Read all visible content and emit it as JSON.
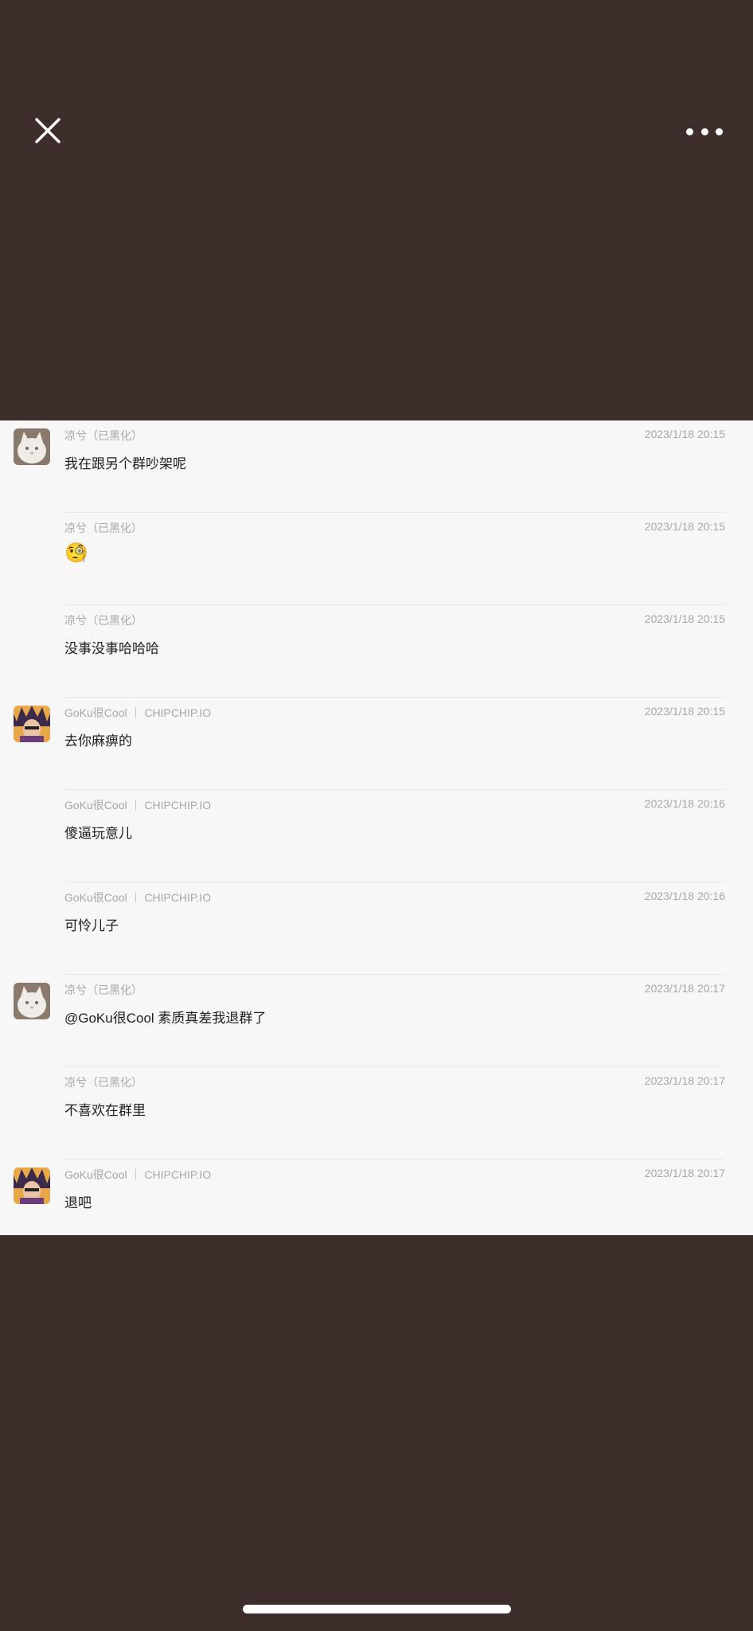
{
  "header": {
    "close_icon": "close-icon",
    "more_icon": "more-horizontal-icon"
  },
  "messages": [
    {
      "sender": "凉兮（已黑化）",
      "time": "2023/1/18 20:15",
      "text": "我在跟另个群吵架呢",
      "avatar": "cat"
    },
    {
      "sender": "凉兮（已黑化）",
      "time": "2023/1/18 20:15",
      "text": "🧐",
      "avatar": ""
    },
    {
      "sender": "凉兮（已黑化）",
      "time": "2023/1/18 20:15",
      "text": "没事没事哈哈哈",
      "avatar": ""
    },
    {
      "sender": "GoKu很Cool ｜ CHIPCHIP.IO",
      "time": "2023/1/18 20:15",
      "text": "去你麻痹的",
      "avatar": "goku"
    },
    {
      "sender": "GoKu很Cool ｜ CHIPCHIP.IO",
      "time": "2023/1/18 20:16",
      "text": "傻逼玩意儿",
      "avatar": ""
    },
    {
      "sender": "GoKu很Cool ｜ CHIPCHIP.IO",
      "time": "2023/1/18 20:16",
      "text": "可怜儿子",
      "avatar": ""
    },
    {
      "sender": "凉兮（已黑化）",
      "time": "2023/1/18 20:17",
      "text": "@GoKu很Cool 素质真差我退群了",
      "avatar": "cat"
    },
    {
      "sender": "凉兮（已黑化）",
      "time": "2023/1/18 20:17",
      "text": "不喜欢在群里",
      "avatar": ""
    },
    {
      "sender": "GoKu很Cool ｜ CHIPCHIP.IO",
      "time": "2023/1/18 20:17",
      "text": "退吧",
      "avatar": "goku"
    }
  ]
}
